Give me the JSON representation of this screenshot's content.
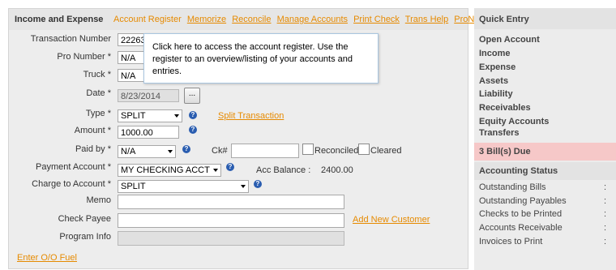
{
  "header": {
    "title": "Income and Expense",
    "links": [
      "Account Register",
      "Memorize",
      "Reconcile",
      "Manage Accounts",
      "Print Check",
      "Trans Help",
      "ProNotes"
    ]
  },
  "tooltip": {
    "text": "Click here to access the account register. Use the register to an overview/listing of your accounts and entries."
  },
  "form": {
    "transaction_number": {
      "label": "Transaction Number",
      "value": "22263"
    },
    "pro_number": {
      "label": "Pro Number *",
      "value": "N/A"
    },
    "truck": {
      "label": "Truck *",
      "value": "N/A"
    },
    "date": {
      "label": "Date *",
      "value": "8/23/2014",
      "button": "..."
    },
    "type": {
      "label": "Type *",
      "value": "SPLIT",
      "link": "Split Transaction"
    },
    "amount": {
      "label": "Amount *",
      "value": "1000.00"
    },
    "paid_by": {
      "label": "Paid by *",
      "value": "N/A",
      "ck_label": "Ck#",
      "ck_value": "",
      "reconciled": "Reconciled",
      "cleared": "Cleared"
    },
    "payment_account": {
      "label": "Payment Account *",
      "value": "MY CHECKING ACCT",
      "balance_label": "Acc Balance :",
      "balance_value": "2400.00"
    },
    "charge_to_account": {
      "label": "Charge to Account *",
      "value": "SPLIT"
    },
    "memo": {
      "label": "Memo",
      "value": ""
    },
    "check_payee": {
      "label": "Check Payee",
      "value": "",
      "link": "Add New Customer"
    },
    "program_info": {
      "label": "Program Info",
      "value": ""
    },
    "help_icon": "?",
    "fuel_link": "Enter O/O Fuel"
  },
  "sidebar": {
    "quick_entry_title": "Quick Entry",
    "items": [
      "Open Account",
      "Income",
      "Expense",
      "Assets",
      "Liability",
      "Receivables",
      "Equity Accounts",
      "Transfers"
    ],
    "bills_due": "3 Bill(s) Due",
    "status_title": "Accounting Status",
    "status_items": [
      "Outstanding Bills",
      "Outstanding Payables",
      "Checks to be Printed",
      "Accounts Receivable",
      "Invoices to Print"
    ],
    "colon": ":"
  },
  "colors": {
    "accent": "#e68a00",
    "due_bg": "#f6c8c8",
    "help": "#2a5db0"
  }
}
